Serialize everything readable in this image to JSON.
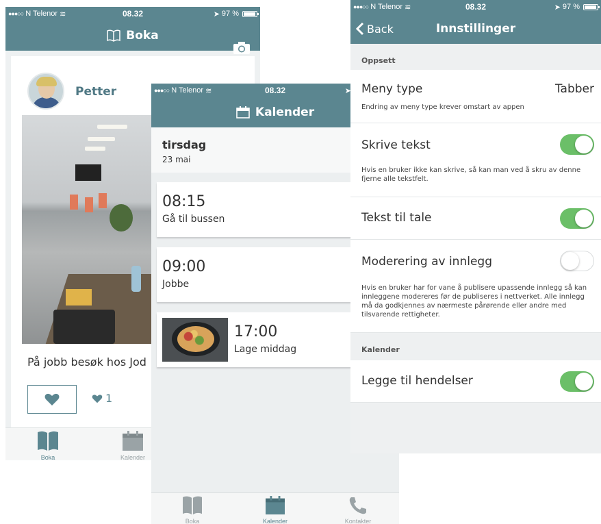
{
  "statusbar": {
    "carrier": "N Telenor",
    "time": "08.32",
    "battery_boka": "97 %",
    "battery_inn": "97 %"
  },
  "boka": {
    "title": "Boka",
    "post": {
      "author": "Petter",
      "text": "På jobb besøk hos Jod",
      "like_count": "1"
    },
    "tabs": [
      {
        "label": "Boka"
      },
      {
        "label": "Kalender"
      }
    ]
  },
  "kalender": {
    "title": "Kalender",
    "day_name": "tirsdag",
    "day_date": "23 mai",
    "events": [
      {
        "time": "08:15",
        "title": "Gå til bussen"
      },
      {
        "time": "09:00",
        "title": "Jobbe"
      },
      {
        "time": "17:00",
        "title": "Lage middag"
      }
    ],
    "tabs": [
      {
        "label": "Boka"
      },
      {
        "label": "Kalender"
      },
      {
        "label": "Kontakter"
      }
    ]
  },
  "innstillinger": {
    "back_label": "Back",
    "title": "Innstillinger",
    "section_oppsett": "Oppsett",
    "meny_type_label": "Meny type",
    "meny_type_value": "Tabber",
    "meny_type_desc": "Endring av meny type krever omstart av appen",
    "skrive_tekst_label": "Skrive tekst",
    "skrive_tekst_desc": "Hvis en bruker ikke kan skrive, så kan man ved å skru av denne fjerne alle tekstfelt.",
    "tekst_til_tale_label": "Tekst til tale",
    "moderering_label": "Moderering av innlegg",
    "moderering_desc": "Hvis en bruker har for vane å publisere upassende innlegg så kan innleggene modereres før de publiseres i nettverket. Alle innlegg må da godkjennes av nærmeste pårørende eller andre med tilsvarende rettigheter.",
    "section_kalender": "Kalender",
    "legge_til_label": "Legge til hendelser",
    "toggles": {
      "skrive_tekst": true,
      "tekst_til_tale": true,
      "moderering": false,
      "legge_til": true
    }
  },
  "colors": {
    "accent": "#5b8690",
    "toggle_on": "#6bbf68"
  }
}
